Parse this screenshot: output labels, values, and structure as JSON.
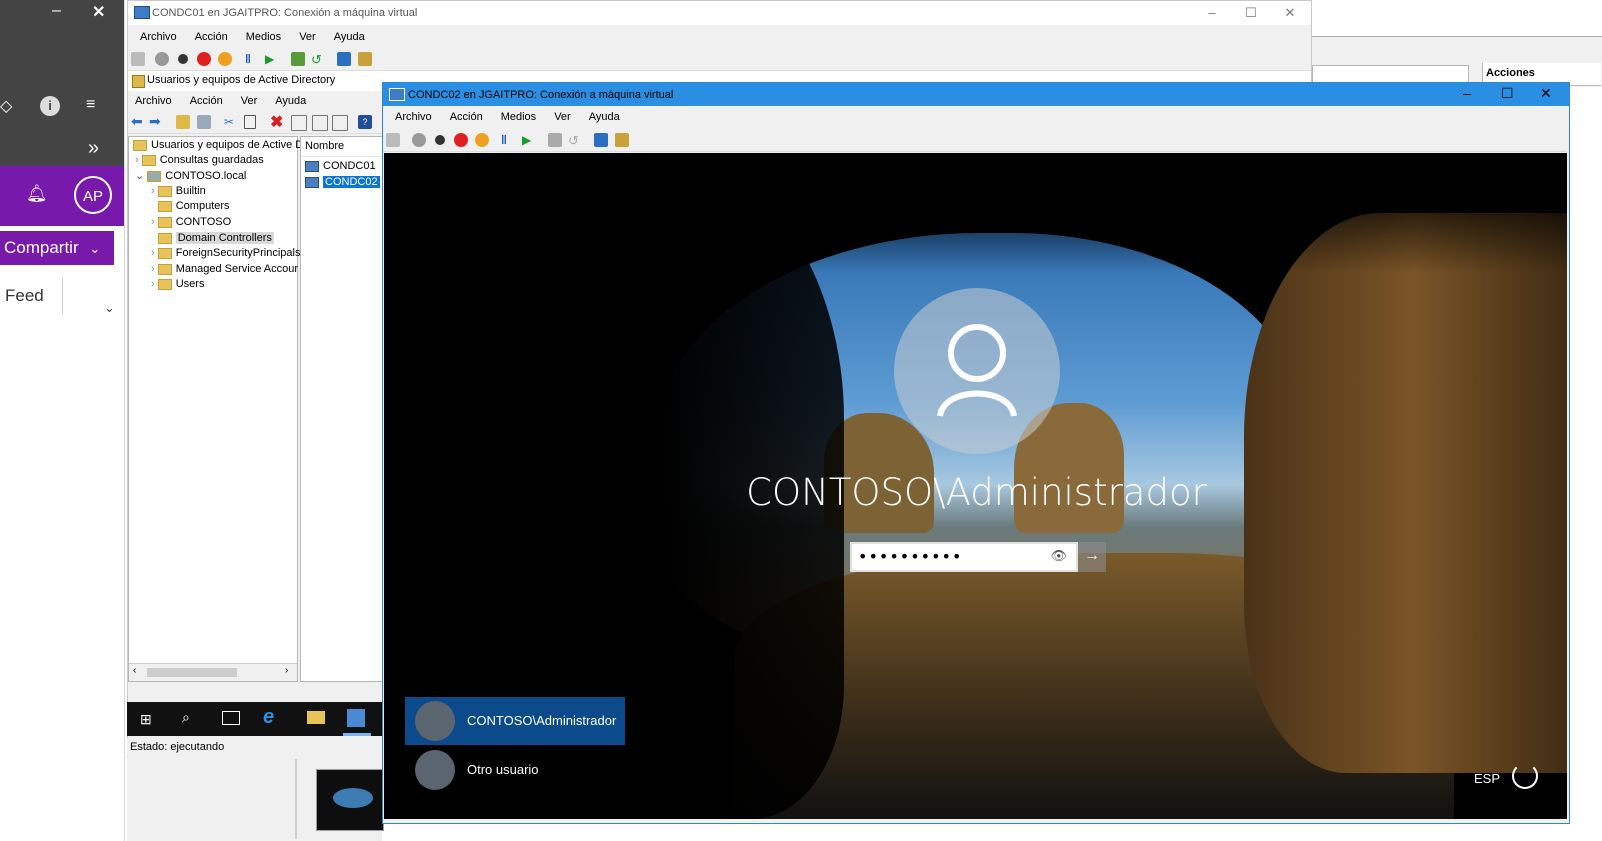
{
  "left_app": {
    "bell_icon": "bell-icon",
    "avatar_initials": "AP",
    "share_label": "Compartir",
    "feed_label": "Feed"
  },
  "vm1": {
    "title": "CONDC01 en JGAITPRO: Conexión a máquina virtual",
    "menu": [
      "Archivo",
      "Acción",
      "Medios",
      "Ver",
      "Ayuda"
    ],
    "inner_title": "Usuarios y equipos de Active Directory",
    "inner_menu": [
      "Archivo",
      "Acción",
      "Ver",
      "Ayuda"
    ],
    "tree": {
      "root": "Usuarios y equipos de Active Dir",
      "saved": "Consultas guardadas",
      "domain": "CONTOSO.local",
      "children": [
        "Builtin",
        "Computers",
        "CONTOSO",
        "Domain Controllers",
        "ForeignSecurityPrincipals",
        "Managed Service Accour",
        "Users"
      ]
    },
    "list_header": "Nombre",
    "list_items": [
      "CONDC01",
      "CONDC02"
    ],
    "status": "Estado: ejecutando"
  },
  "right_panel": {
    "acciones": "Acciones"
  },
  "vm2": {
    "title": "CONDC02 en JGAITPRO: Conexión a máquina virtual",
    "menu": [
      "Archivo",
      "Acción",
      "Medios",
      "Ver",
      "Ayuda"
    ],
    "login": {
      "username": "CONTOSO\\Administrador",
      "password_mask": "••••••••••",
      "users": [
        "CONTOSO\\Administrador",
        "Otro usuario"
      ],
      "language": "ESP"
    }
  },
  "colors": {
    "accent_purple": "#7719aa",
    "title_blue": "#2a8fe3",
    "selected_user": "#0b4b8c"
  }
}
